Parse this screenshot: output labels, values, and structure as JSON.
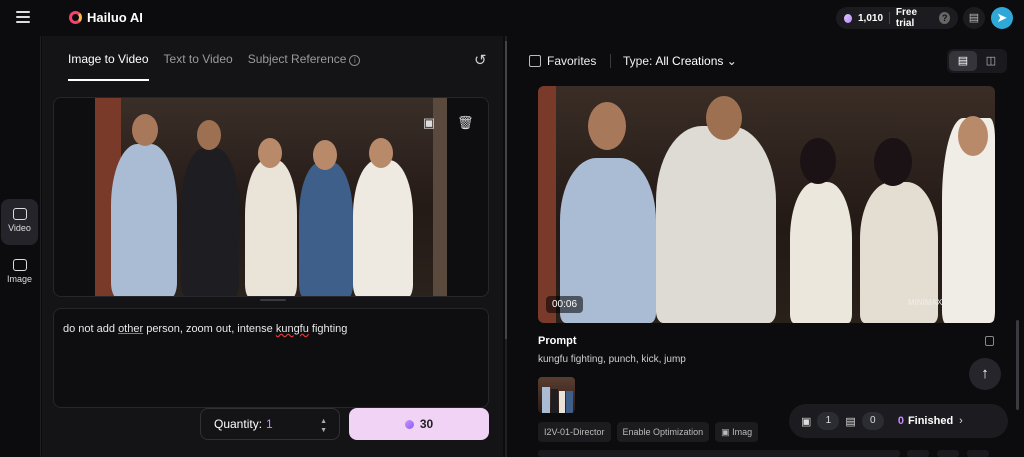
{
  "app": {
    "name": "Hailuo AI",
    "brand_color": "#f5426c",
    "accent": "#c58cff"
  },
  "header": {
    "menu_icon": "hamburger-icon",
    "credits": "1,010",
    "free_trial": "Free trial",
    "help": "?",
    "icon_book": "book-icon",
    "avatar_icon": "plane-avatar-icon"
  },
  "rail": {
    "items": [
      {
        "label": "Video",
        "icon": "video-icon",
        "active": true
      },
      {
        "label": "Image",
        "icon": "image-icon",
        "active": false
      }
    ]
  },
  "left": {
    "tabs": [
      {
        "label": "Image to Video",
        "active": true
      },
      {
        "label": "Text to Video",
        "active": false
      },
      {
        "label": "Subject Reference",
        "active": false
      }
    ],
    "info": "i",
    "image_tools": {
      "replace": "image-icon",
      "delete": "trash-icon"
    },
    "prompt": {
      "pre": "do not add ",
      "w1": "other",
      "mid": " person, zoom out, intense ",
      "w2": "kungfu",
      "post": " fighting"
    },
    "quantity_label": "Quantity:",
    "quantity_value": "1",
    "generate_cost": "30"
  },
  "right": {
    "favorites": "Favorites",
    "type_label": "Type:",
    "type_value": "All Creations",
    "video_time": "00:06",
    "watermark_a": "MINIMAX",
    "watermark_b": "Hailuo AI",
    "prompt_heading": "Prompt",
    "prompt_text": "kungfu fighting, punch, kick, jump",
    "chips": [
      "I2V-01-Director",
      "Enable Optimization",
      "Imag"
    ],
    "status": {
      "video_count": "1",
      "image_count": "0",
      "finished_count": "0",
      "finished_label": "Finished"
    }
  }
}
